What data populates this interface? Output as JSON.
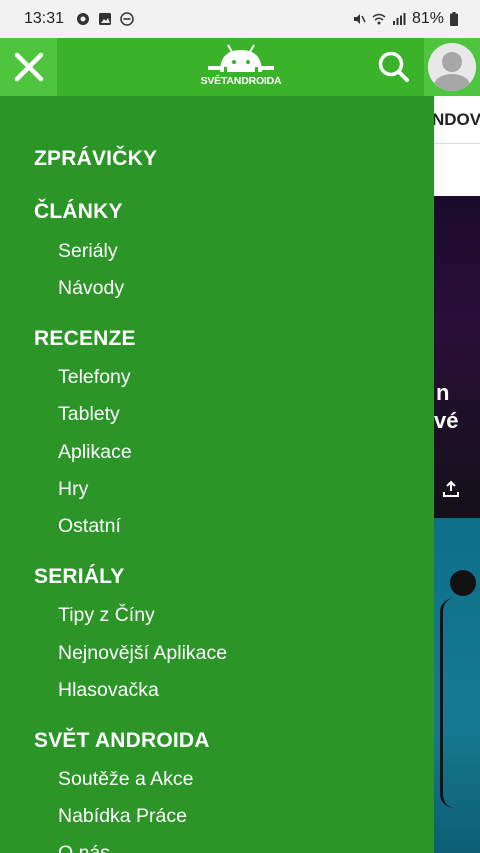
{
  "status_bar": {
    "time": "13:31",
    "battery": "81%"
  },
  "header": {
    "logo_text": "SVĚTANDROIDA"
  },
  "background_page": {
    "tab_text": "NDOVA",
    "card_text_1": "n",
    "card_text_2": "vé"
  },
  "menu": {
    "sections": [
      {
        "title": "ZPRÁVIČKY",
        "items": []
      },
      {
        "title": "ČLÁNKY",
        "items": [
          "Seriály",
          "Návody"
        ]
      },
      {
        "title": "RECENZE",
        "items": [
          "Telefony",
          "Tablety",
          "Aplikace",
          "Hry",
          "Ostatní"
        ]
      },
      {
        "title": "SERIÁLY",
        "items": [
          "Tipy z Číny",
          "Nejnovější Aplikace",
          "Hlasovačka"
        ]
      },
      {
        "title": "SVĚT ANDROIDA",
        "items": [
          "Soutěže a Akce",
          "Nabídka Práce",
          "O nás"
        ]
      }
    ]
  },
  "colors": {
    "drawer_bg": "#2b9528",
    "header_bg": "#3ab32b",
    "header_button_bg": "#4ec43f"
  }
}
